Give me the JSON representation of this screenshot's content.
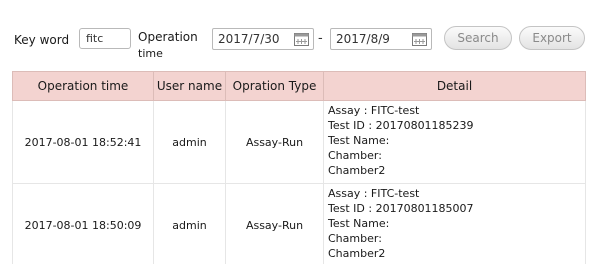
{
  "filters": {
    "keyword_label": "Key word",
    "keyword_value": "fitc",
    "operation_time_label_line1": "Operation",
    "operation_time_label_line2": "time",
    "start_date": "2017/7/30",
    "separator": "-",
    "end_date": "2017/8/9",
    "search_label": "Search",
    "export_label": "Export"
  },
  "table": {
    "columns": [
      "Operation time",
      "User name",
      "Opration Type",
      "Detail"
    ],
    "rows": [
      {
        "time": "2017-08-01 18:52:41",
        "user": "admin",
        "type": "Assay-Run",
        "detail": [
          "Assay : FITC-test",
          "Test ID : 20170801185239",
          "Test Name:",
          "Chamber:",
          "Chamber2"
        ]
      },
      {
        "time": "2017-08-01 18:50:09",
        "user": "admin",
        "type": "Assay-Run",
        "detail": [
          "Assay : FITC-test",
          "Test ID : 20170801185007",
          "Test Name:",
          "Chamber:",
          "Chamber2"
        ]
      }
    ]
  },
  "icons": {
    "calendar": "calendar-icon"
  },
  "colors": {
    "header_bg": "#f3d3d0",
    "button_text": "#8a8a8a"
  }
}
